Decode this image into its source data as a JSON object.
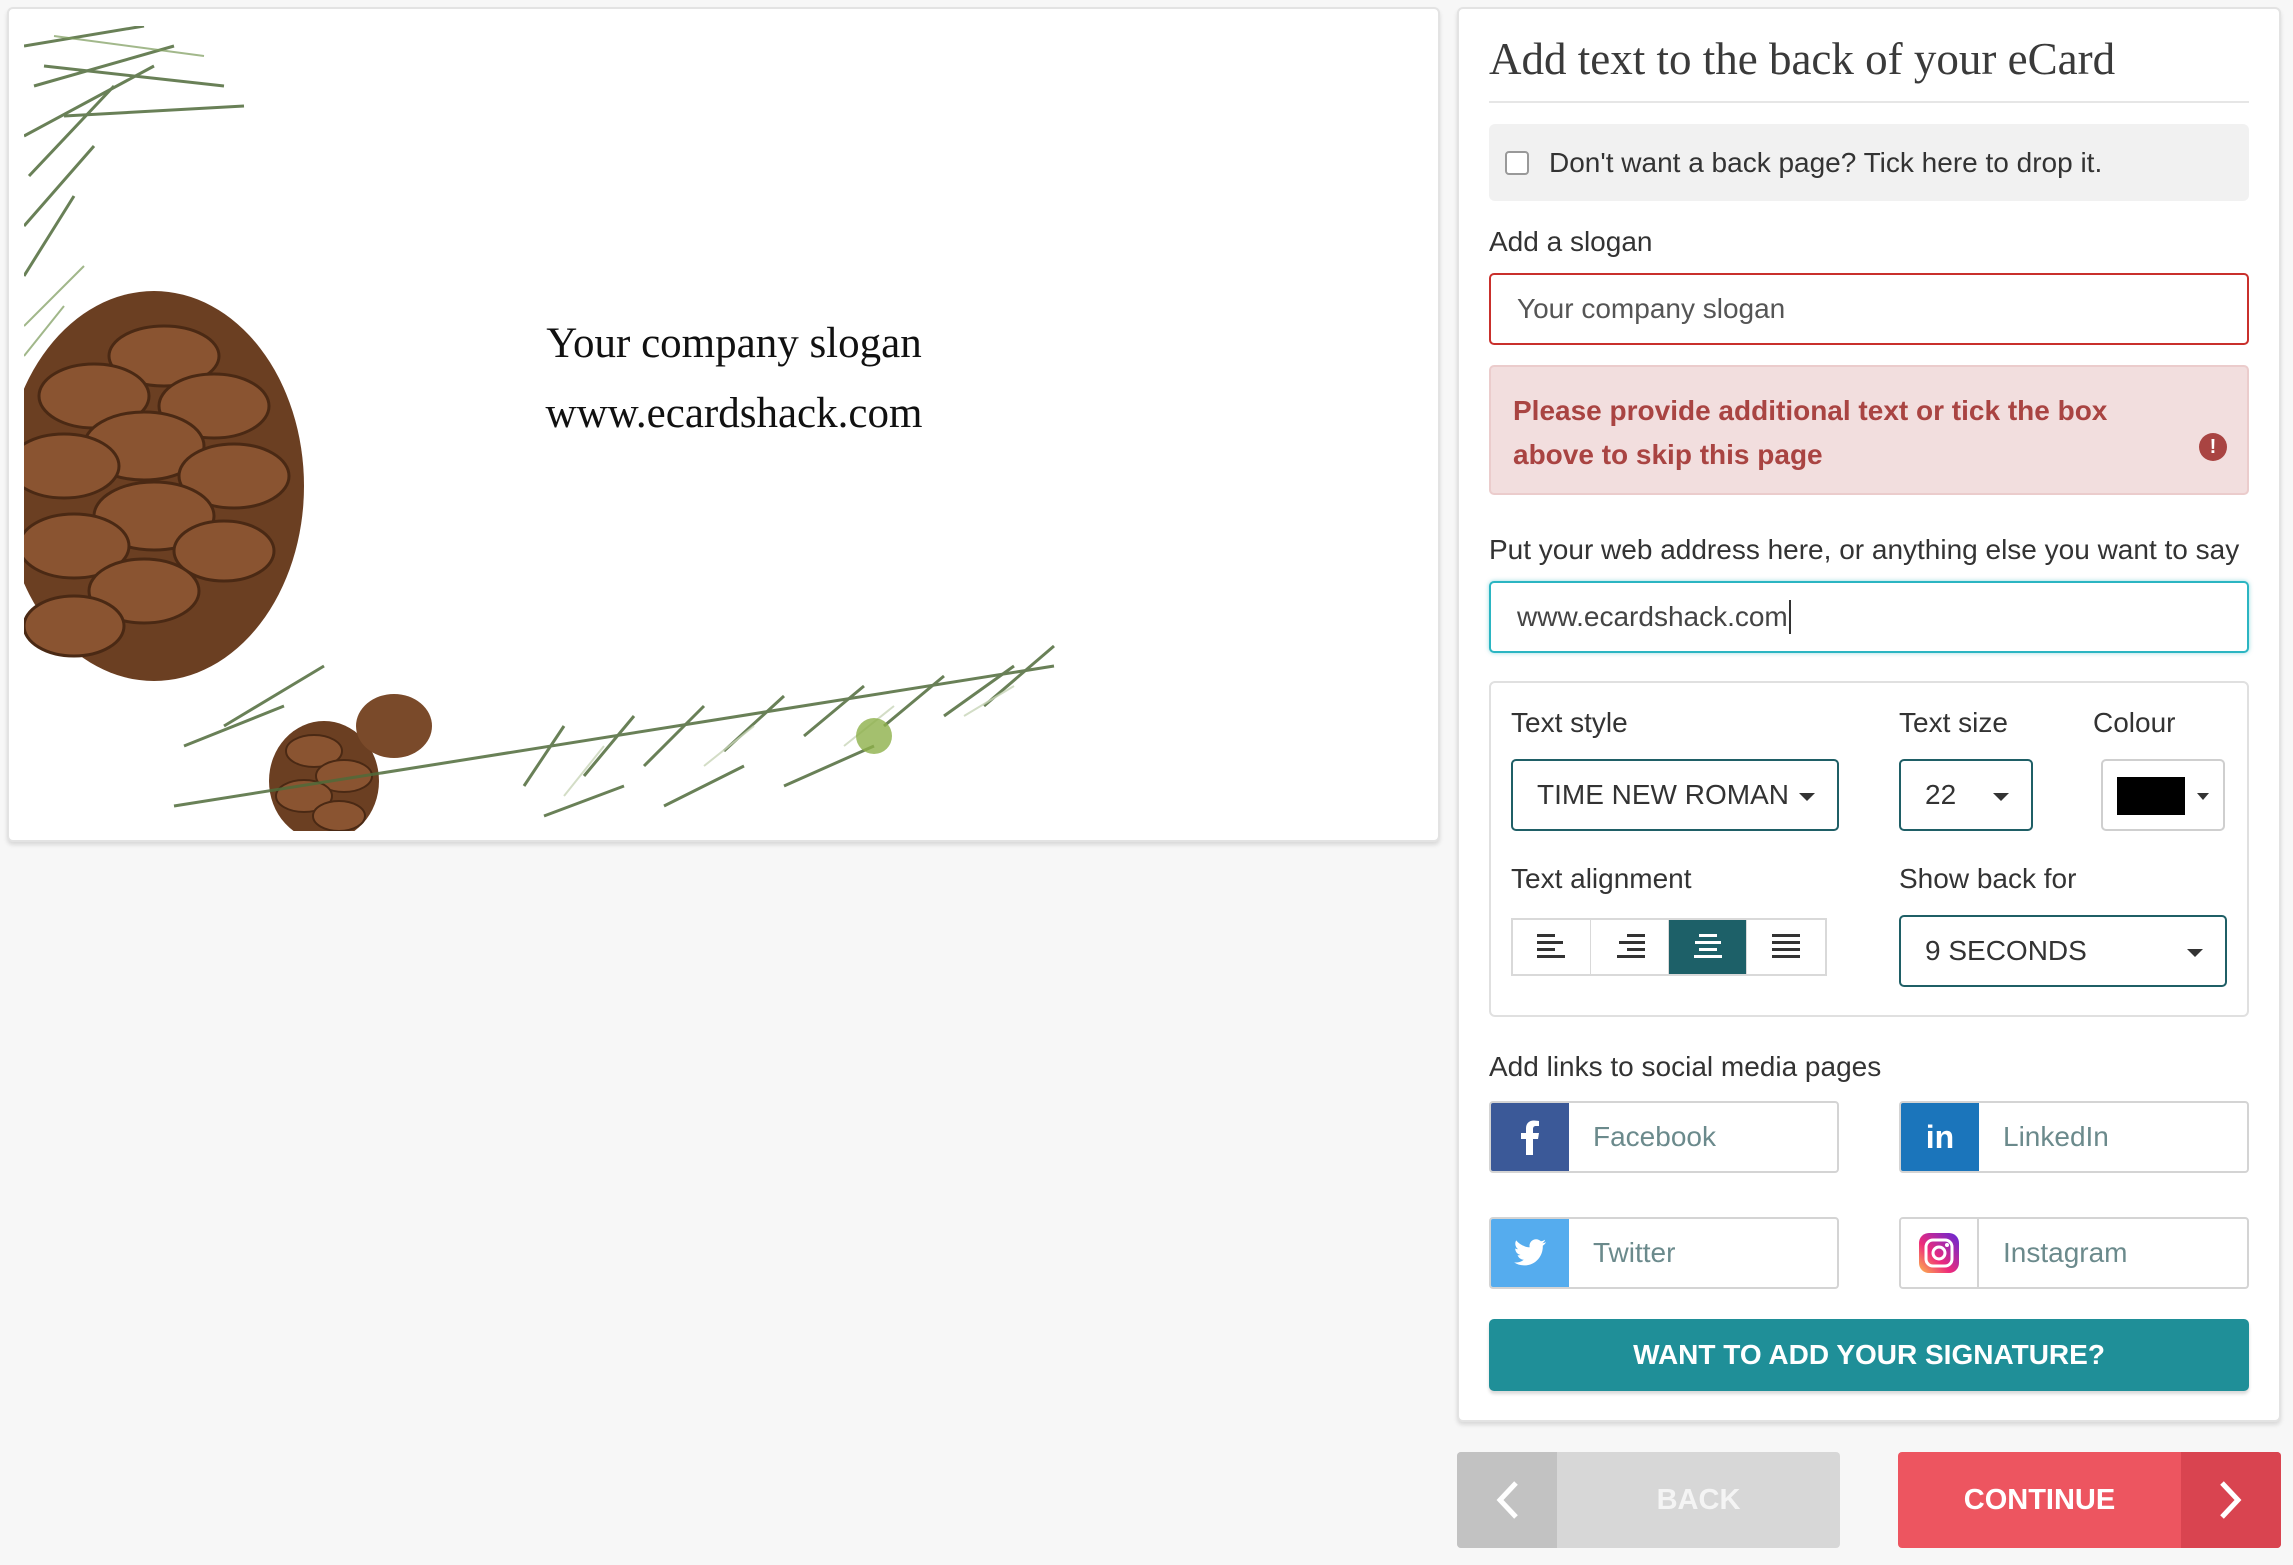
{
  "preview": {
    "slogan": "Your company slogan",
    "web": "www.ecardshack.com"
  },
  "panel": {
    "title": "Add text to the back of your eCard",
    "skip_label": "Don't want a back page? Tick here to drop it.",
    "skip_checked": false,
    "slogan_label": "Add a slogan",
    "slogan_placeholder": "Your company slogan",
    "error_text": "Please provide additional text or tick the box above to skip this page",
    "error_icon": "exclamation-circle-icon",
    "web_label": "Put your web address here, or anything else you want to say",
    "web_value": "www.ecardshack.com",
    "text_style_label": "Text style",
    "text_style_value": "TIME NEW ROMAN",
    "text_size_label": "Text size",
    "text_size_value": "22",
    "colour_label": "Colour",
    "colour_value": "#000000",
    "alignment_label": "Text alignment",
    "alignment_options": [
      "left",
      "right",
      "center",
      "justify"
    ],
    "alignment_selected": "center",
    "show_back_label": "Show back for",
    "show_back_value": "9 SECONDS",
    "social_label": "Add links to social media pages",
    "social": {
      "facebook": "Facebook",
      "linkedin": "LinkedIn",
      "twitter": "Twitter",
      "instagram": "Instagram"
    },
    "signature_button": "WANT TO ADD YOUR SIGNATURE?"
  },
  "nav": {
    "back": "BACK",
    "continue": "CONTINUE"
  },
  "colors": {
    "accent": "#1f8f98",
    "error": "#a94442",
    "continue": "#ed5560",
    "facebook": "#3b5998",
    "linkedin": "#1b75bb",
    "twitter": "#55acee"
  }
}
